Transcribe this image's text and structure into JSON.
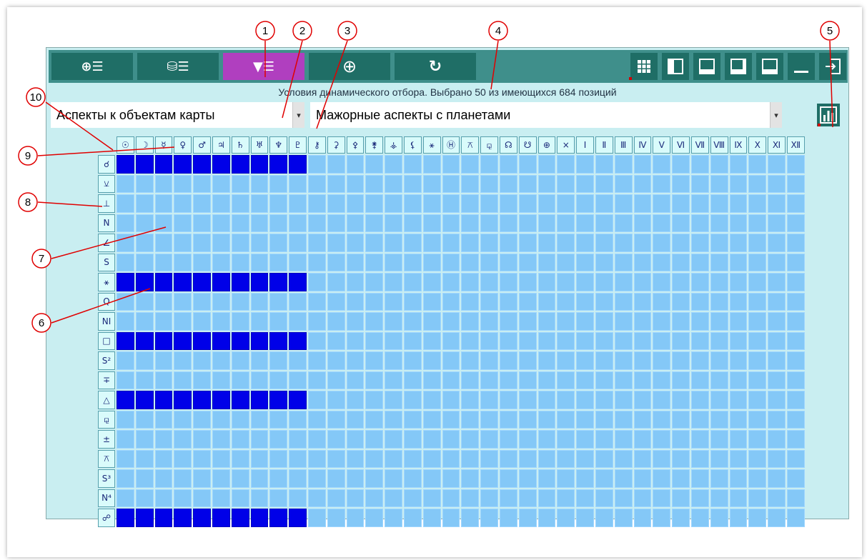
{
  "toolbar": {
    "tabs": [
      {
        "label": "⊕☰",
        "icon": "chart-list-icon",
        "active": false
      },
      {
        "label": "⛁☰",
        "icon": "database-list-icon",
        "active": false
      },
      {
        "label": "▼☰",
        "icon": "filter-list-icon",
        "active": true
      },
      {
        "label": "⊕",
        "icon": "crosshair-icon",
        "active": false
      },
      {
        "label": "↻",
        "icon": "refresh-icon",
        "active": false
      }
    ],
    "right_buttons": [
      "grid-icon",
      "layout-left-icon",
      "layout-bottom-icon",
      "layout-bottom-right-icon",
      "layout-top-icon",
      "minimize-icon",
      "exit-icon"
    ]
  },
  "status_text": "Условия динамического отбора. Выбрано 50 из имеющихся 684 позиций",
  "select1": {
    "value": "Аспекты к объектам карты"
  },
  "select2": {
    "value": "Мажорные аспекты с планетами"
  },
  "grid": {
    "columns": [
      "☉",
      "☽",
      "☿",
      "♀",
      "♂",
      "♃",
      "♄",
      "♅",
      "♆",
      "♇",
      "⚷",
      "⚳",
      "⚴",
      "⚵",
      "⚶",
      "⚸",
      "⚹",
      "Ⓗ",
      "⚻",
      "⚼",
      "☊",
      "☋",
      "⊕",
      "×",
      "Ⅰ",
      "Ⅱ",
      "Ⅲ",
      "Ⅳ",
      "Ⅴ",
      "Ⅵ",
      "Ⅶ",
      "Ⅷ",
      "Ⅸ",
      "Ⅹ",
      "Ⅺ",
      "Ⅻ"
    ],
    "rows": [
      "☌",
      "⚺",
      "⊥",
      "N",
      "∠",
      "S",
      "⚹",
      "Q",
      "NI",
      "□",
      "S²",
      "∓",
      "△",
      "⚼",
      "±",
      "⚻",
      "S³",
      "N⁴",
      "☍"
    ],
    "selected_rows": [
      0,
      6,
      9,
      12,
      18
    ],
    "selected_count_per_row": 10
  },
  "callouts": [
    "1",
    "2",
    "3",
    "4",
    "5",
    "6",
    "7",
    "8",
    "9",
    "10"
  ],
  "colors": {
    "toolbar": "#3f8f8b",
    "button": "#1f6e66",
    "active_tab": "#b03fbf",
    "panel": "#c9eef1",
    "cell": "#84c8f7",
    "cell_selected": "#0000e8"
  }
}
